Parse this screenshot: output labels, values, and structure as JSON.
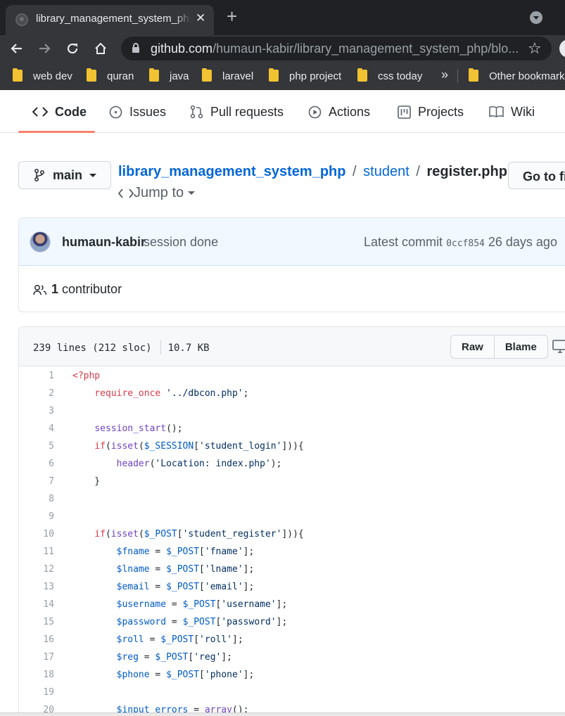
{
  "browser": {
    "tab_title": "library_management_system_php/register.php",
    "url_host": "github.com",
    "url_path": "/humaun-kabir/library_management_system_php/blo...",
    "bookmarks": [
      "web dev",
      "quran",
      "java",
      "laravel",
      "php project",
      "css today"
    ],
    "bookmarks_overflow": "»",
    "other_bookmarks": "Other bookmarks"
  },
  "repo_nav": {
    "items": [
      {
        "label": "Code",
        "icon": "code-icon",
        "active": true
      },
      {
        "label": "Issues",
        "icon": "issue-opened-icon"
      },
      {
        "label": "Pull requests",
        "icon": "git-pull-request-icon"
      },
      {
        "label": "Actions",
        "icon": "play-icon"
      },
      {
        "label": "Projects",
        "icon": "project-icon"
      },
      {
        "label": "Wiki",
        "icon": "book-icon"
      }
    ]
  },
  "breadcrumb": {
    "branch": "main",
    "repo": "library_management_system_php",
    "folder": "student",
    "file": "register.php",
    "separator": "/",
    "jump_to": "Jump to",
    "go_to_file": "Go to file"
  },
  "commit": {
    "author": "humaun-kabir",
    "message": "session done",
    "latest_label": "Latest commit",
    "sha": "0ccf854",
    "age": "26 days ago",
    "contributors_count": "1",
    "contributors_label": "contributor"
  },
  "file": {
    "lines_info": "239 lines (212 sloc)",
    "size": "10.7 KB",
    "raw_label": "Raw",
    "blame_label": "Blame"
  },
  "code_lines": [
    {
      "n": "1",
      "t": "<?php"
    },
    {
      "n": "2",
      "t": "    require_once '../dbcon.php';"
    },
    {
      "n": "3",
      "t": ""
    },
    {
      "n": "4",
      "t": "    session_start();"
    },
    {
      "n": "5",
      "t": "    if(isset($_SESSION['student_login'])){"
    },
    {
      "n": "6",
      "t": "        header('Location: index.php');"
    },
    {
      "n": "7",
      "t": "    }"
    },
    {
      "n": "8",
      "t": ""
    },
    {
      "n": "9",
      "t": ""
    },
    {
      "n": "10",
      "t": "    if(isset($_POST['student_register'])){"
    },
    {
      "n": "11",
      "t": "        $fname = $_POST['fname'];"
    },
    {
      "n": "12",
      "t": "        $lname = $_POST['lname'];"
    },
    {
      "n": "13",
      "t": "        $email = $_POST['email'];"
    },
    {
      "n": "14",
      "t": "        $username = $_POST['username'];"
    },
    {
      "n": "15",
      "t": "        $password = $_POST['password'];"
    },
    {
      "n": "16",
      "t": "        $roll = $_POST['roll'];"
    },
    {
      "n": "17",
      "t": "        $reg = $_POST['reg'];"
    },
    {
      "n": "18",
      "t": "        $phone = $_POST['phone'];"
    },
    {
      "n": "19",
      "t": ""
    },
    {
      "n": "20",
      "t": "        $input_errors = array();"
    }
  ],
  "colors": {
    "link": "#0366d6",
    "nav_active_underline": "#f9826c",
    "keyword": "#d73a49",
    "function": "#6f42c1",
    "string": "#032f62",
    "variable": "#005cc5"
  }
}
